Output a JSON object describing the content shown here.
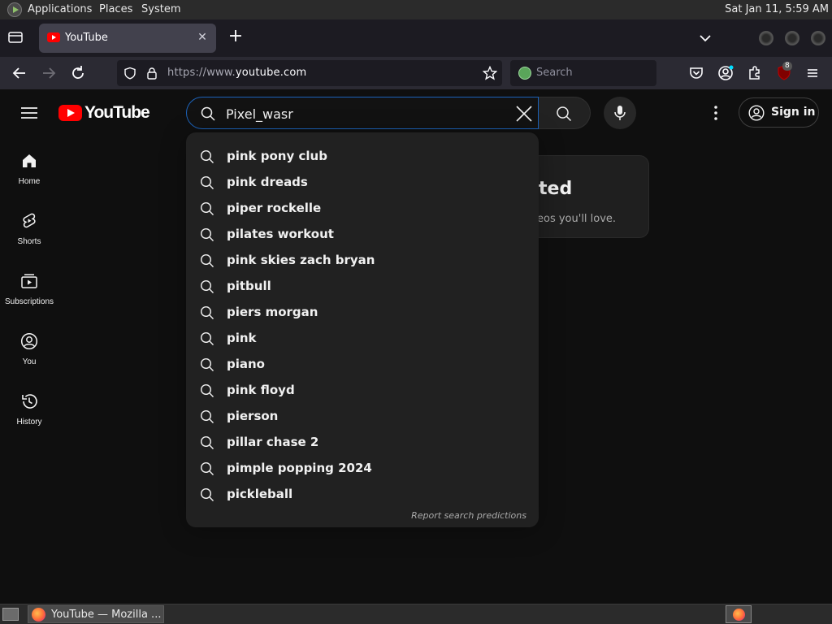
{
  "top_panel": {
    "menus": [
      "Applications",
      "Places",
      "System"
    ],
    "clock": "Sat Jan 11,  5:59 AM"
  },
  "browser": {
    "tab": {
      "title": "YouTube",
      "close_glyph": "✕"
    },
    "new_tab_glyph": "+",
    "url": {
      "scheme": "https://www.",
      "host": "youtube.com"
    },
    "search_placeholder": "Search",
    "extension_badge": "8"
  },
  "youtube": {
    "logo_text": "YouTube",
    "search": {
      "query": "Pixel_wasr"
    },
    "signin_label": "Sign in",
    "guide": [
      {
        "label": "Home",
        "icon": "home-icon"
      },
      {
        "label": "Shorts",
        "icon": "shorts-icon"
      },
      {
        "label": "Subscriptions",
        "icon": "subscriptions-icon"
      },
      {
        "label": "You",
        "icon": "you-icon"
      },
      {
        "label": "History",
        "icon": "history-icon"
      }
    ],
    "background_card": {
      "title_fragment": "ted",
      "body_fragment": "eos you'll love."
    },
    "suggestions": [
      "pink pony club",
      "pink dreads",
      "piper rockelle",
      "pilates workout",
      "pink skies zach bryan",
      "pitbull",
      "piers morgan",
      "pink",
      "piano",
      "pink floyd",
      "pierson",
      "pillar chase 2",
      "pimple popping 2024",
      "pickleball"
    ],
    "report_link": "Report search predictions"
  },
  "taskbar": {
    "window_label": "YouTube — Mozilla ..."
  },
  "colors": {
    "yt_background": "#0f0f0f",
    "yt_red": "#ff0000",
    "search_focus_border": "#1c62b9",
    "dropdown_bg": "#212121",
    "firefox_toolbar": "#2b2a33",
    "firefox_tabstrip": "#1c1b22"
  }
}
